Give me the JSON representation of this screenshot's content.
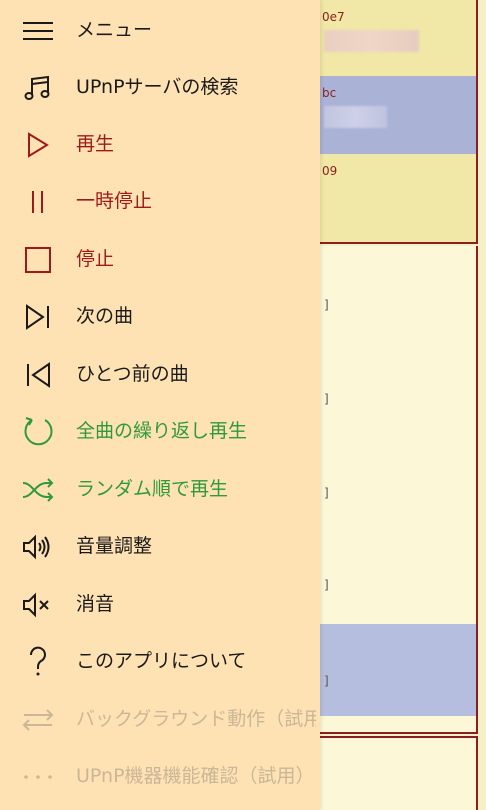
{
  "background": {
    "rows": [
      {
        "id": "0e7"
      },
      {
        "id": "bc"
      },
      {
        "id": "09"
      }
    ],
    "brackets": [
      "]",
      "]",
      "]",
      "]",
      "]"
    ]
  },
  "menu": {
    "items": [
      {
        "label": "メニュー",
        "icon": "hamburger-icon"
      },
      {
        "label": "UPnPサーバの検索",
        "icon": "music-note-icon"
      },
      {
        "label": "再生",
        "icon": "play-icon"
      },
      {
        "label": "一時停止",
        "icon": "pause-icon"
      },
      {
        "label": "停止",
        "icon": "stop-icon"
      },
      {
        "label": "次の曲",
        "icon": "next-track-icon"
      },
      {
        "label": "ひとつ前の曲",
        "icon": "previous-track-icon"
      },
      {
        "label": "全曲の繰り返し再生",
        "icon": "repeat-icon"
      },
      {
        "label": "ランダム順で再生",
        "icon": "shuffle-icon"
      },
      {
        "label": "音量調整",
        "icon": "volume-icon"
      },
      {
        "label": "消音",
        "icon": "mute-icon"
      },
      {
        "label": "このアプリについて",
        "icon": "question-icon"
      },
      {
        "label": "バックグラウンド動作（試用）",
        "icon": "swap-arrows-icon"
      },
      {
        "label": "UPnP機器機能確認（試用）",
        "icon": "more-dots-icon"
      }
    ]
  },
  "colors": {
    "menu_bg": "#ffe2b4",
    "text_dark": "#1a1a1a",
    "accent_red": "#9e1a1a",
    "accent_green": "#2e9a3a",
    "disabled": "#c9b797",
    "list_border": "#8b1f1f"
  }
}
